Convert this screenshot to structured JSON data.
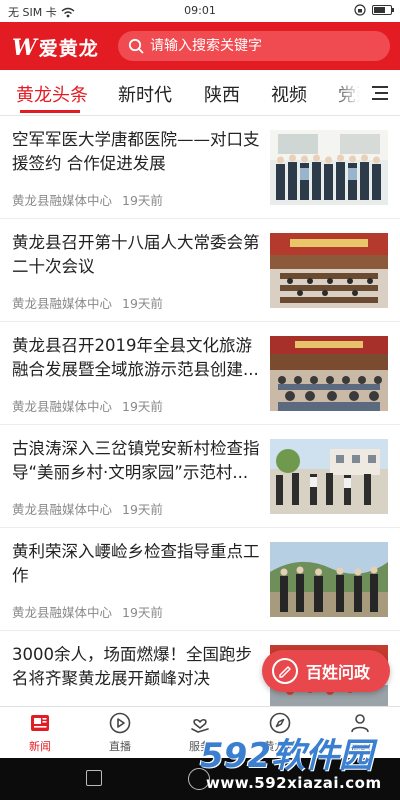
{
  "status_bar": {
    "carrier": "无 SIM 卡",
    "time": "09:01"
  },
  "header": {
    "logo_mark": "W",
    "logo_text": "爱黄龙",
    "search_placeholder": "请输入搜索关键字"
  },
  "tabs": [
    {
      "label": "黄龙头条",
      "active": true
    },
    {
      "label": "新时代",
      "active": false
    },
    {
      "label": "陕西",
      "active": false
    },
    {
      "label": "视频",
      "active": false
    },
    {
      "label": "党建",
      "active": false
    }
  ],
  "news": [
    {
      "title": "空军军医大学唐都医院——对口支援签约 合作促进发展",
      "source": "黄龙县融媒体中心",
      "time": "19天前",
      "thumb": "group-photo"
    },
    {
      "title": "黄龙县召开第十八届人大常委会第二十次会议",
      "source": "黄龙县融媒体中心",
      "time": "19天前",
      "thumb": "meeting-hall"
    },
    {
      "title": "黄龙县召开2019年全县文化旅游融合发展暨全域旅游示范县创建...",
      "source": "黄龙县融媒体中心",
      "time": "19天前",
      "thumb": "conference"
    },
    {
      "title": "古浪涛深入三岔镇党安新村检查指导“美丽乡村·文明家园”示范村...",
      "source": "黄龙县融媒体中心",
      "time": "19天前",
      "thumb": "village-inspection"
    },
    {
      "title": "黄利荣深入崾崄乡检查指导重点工作",
      "source": "黄龙县融媒体中心",
      "time": "19天前",
      "thumb": "outdoor-inspection"
    },
    {
      "title": "3000余人，场面燃爆！全国跑步名将齐聚黄龙展开巅峰对决",
      "source": "",
      "time": "",
      "thumb": "running-event"
    }
  ],
  "float_button": {
    "label": "百姓问政",
    "icon": "edit-icon"
  },
  "bottom_nav": [
    {
      "label": "新闻",
      "icon": "news-icon",
      "active": true
    },
    {
      "label": "直播",
      "icon": "play-icon",
      "active": false
    },
    {
      "label": "服务",
      "icon": "heart-hand-icon",
      "active": false
    },
    {
      "label": "黄龙号",
      "icon": "compass-icon",
      "active": false
    },
    {
      "label": "我的",
      "icon": "user-icon",
      "active": false
    }
  ],
  "watermark": {
    "text": "592软件园",
    "url": "www.592xiazai.com"
  },
  "colors": {
    "brand": "#e31c23",
    "meta_text": "#8a8a8a"
  }
}
